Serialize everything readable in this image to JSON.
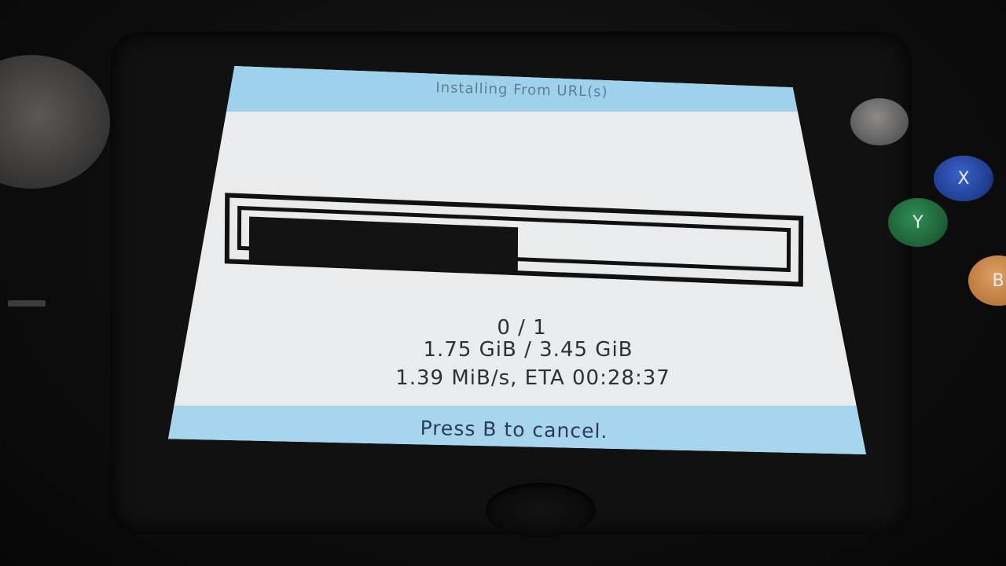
{
  "header": {
    "title": "Installing From URL(s)"
  },
  "progress": {
    "fraction": 0.507,
    "item_count": "0 / 1",
    "size_text": "1.75 GiB / 3.45 GiB",
    "speed_eta_text": "1.39 MiB/s, ETA 00:28:37"
  },
  "footer": {
    "hint": "Press B to cancel."
  },
  "device_buttons": {
    "x_label": "X",
    "y_label": "Y",
    "b_label": "B"
  },
  "colors": {
    "header_bar": "#9dd1ec",
    "footer_bar": "#a7d5ee",
    "screen_bg": "#e9ebec",
    "progress_fill": "#141313"
  }
}
